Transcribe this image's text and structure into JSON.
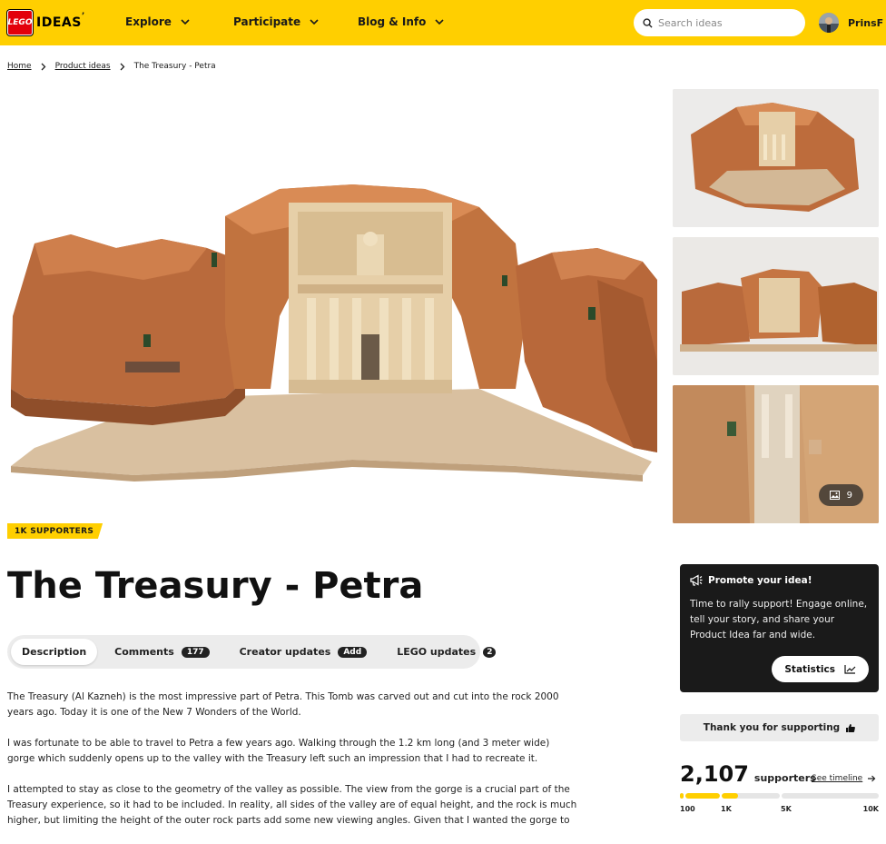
{
  "header": {
    "logo_brand": "LEGO",
    "logo_text": "IDEAS",
    "nav": [
      {
        "label": "Explore"
      },
      {
        "label": "Participate"
      },
      {
        "label": "Blog & Info"
      }
    ],
    "search_placeholder": "Search ideas",
    "username": "PrinsF"
  },
  "breadcrumb": {
    "home": "Home",
    "section": "Product ideas",
    "current": "The Treasury - Petra"
  },
  "gallery": {
    "photo_count": "9"
  },
  "badge": "1K SUPPORTERS",
  "title": "The Treasury - Petra",
  "tabs": [
    {
      "label": "Description",
      "count": ""
    },
    {
      "label": "Comments",
      "count": "177"
    },
    {
      "label": "Creator updates",
      "count": "Add"
    },
    {
      "label": "LEGO updates",
      "count": "2"
    }
  ],
  "description": [
    "The Treasury (Al Kazneh) is the most impressive part of Petra. This Tomb was carved out and cut into the rock 2000 years ago. Today it is one of the New 7 Wonders of the World.",
    "I was fortunate to be able to travel to Petra a few years ago. Walking through the 1.2 km long (and 3 meter wide) gorge which suddenly opens up to the valley with the Treasury left such an impression that I had to recreate it.",
    "I attempted to stay as close to the geometry of the valley as possible. The view from the gorge is a crucial part of the Treasury experience, so it had to be included. In reality, all sides of the valley are of equal height, and the rock is much higher, but limiting the height of the outer rock parts add some new viewing angles. Given that I wanted the gorge to"
  ],
  "promo": {
    "title": "Promote your idea!",
    "text": "Time to rally support! Engage online, tell your story, and share your Product Idea far and wide.",
    "button": "Statistics"
  },
  "thanks_label": "Thank you for supporting",
  "supporters": {
    "count": "2,107",
    "label": "supporters",
    "timeline_link": "See timeline",
    "milestones": [
      "100",
      "1K",
      "5K",
      "10K"
    ],
    "progress_fraction_to_5k": 0.28
  },
  "colors": {
    "brand_yellow": "#ffcf00",
    "brand_red": "#e3000b",
    "dark": "#1a1a1a"
  }
}
